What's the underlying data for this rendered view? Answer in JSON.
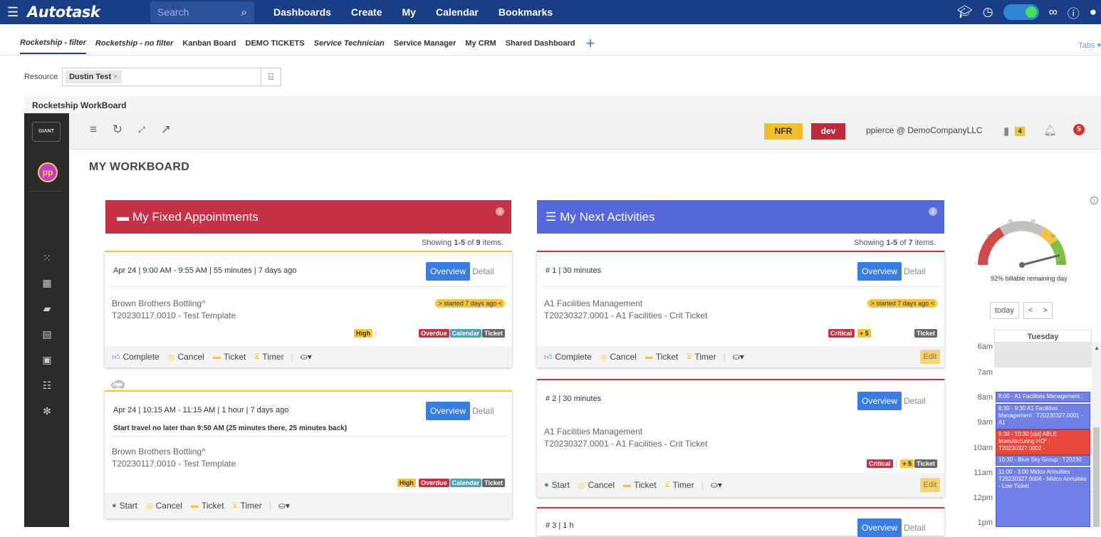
{
  "topnav": {
    "logo": "Autotask",
    "search_placeholder": "Search",
    "menu": [
      "Dashboards",
      "Create",
      "My",
      "Calendar",
      "Bookmarks"
    ]
  },
  "tabs": {
    "items": [
      "Rocketship - filter",
      "Rocketship - no filter",
      "Kanban Board",
      "DEMO TICKETS",
      "Service Technician",
      "Service Manager",
      "My CRM",
      "Shared Dashboard"
    ],
    "right_label": "Tabs"
  },
  "resource": {
    "label": "Resource",
    "chip": "Dustin Test",
    "chip_remove": "×"
  },
  "workboard": {
    "frame_title": "Rocketship WorkBoard",
    "logo_text": "GIANT",
    "avatar": "pp",
    "nfr": "NFR",
    "dev": "dev",
    "user": "ppierce @ DemoCompanyLLC",
    "clip_count": "4",
    "notif_count": "5",
    "page_title": "MY WORKBOARD"
  },
  "fixed": {
    "title": "My Fixed Appointments",
    "showing_prefix": "Showing ",
    "showing_range": "1-5",
    "showing_of": " of ",
    "showing_total": "9",
    "showing_suffix": " items.",
    "cards": [
      {
        "date": "Apr 24",
        "time": "9:00 AM - 9:55 AM",
        "duration": "55 minutes",
        "ago": "7 days ago",
        "overview": "Overview",
        "detail": "Detail",
        "started": "> started 7 days ago <",
        "client": "Brown Brothers Bottling^",
        "ticket": "T20230117.0010 - Test Template",
        "priority": "High",
        "tags": [
          "Overdue",
          "Calendar",
          "Ticket"
        ],
        "actions": [
          "Complete",
          "Cancel",
          "Ticket",
          "Timer"
        ]
      },
      {
        "date": "Apr 24",
        "time": "10:15 AM - 11:15 AM",
        "duration": "1 hour",
        "ago": "7 days ago",
        "travel": "Start travel no later than 9:50 AM (25 minutes there, 25 minutes back)",
        "overview": "Overview",
        "detail": "Detail",
        "client": "Brown Brothers Bottling^",
        "ticket": "T20230117.0010 - Test Template",
        "priority": "High",
        "tags": [
          "Overdue",
          "Calendar",
          "Ticket"
        ],
        "actions": [
          "Start",
          "Cancel",
          "Ticket",
          "Timer"
        ]
      }
    ]
  },
  "next": {
    "title": "My Next Activities",
    "showing_prefix": "Showing ",
    "showing_range": "1-5",
    "showing_of": " of ",
    "showing_total": "7",
    "showing_suffix": " items.",
    "cards": [
      {
        "num": "# 1",
        "duration": "30 minutes",
        "overview": "Overview",
        "detail": "Detail",
        "started": "> started 7 days ago <",
        "client": "A1 Facilities Management",
        "ticket": "T20230327.0001 - A1 Facilities - Crit Ticket",
        "priority": "Critical",
        "plus": "+ 5",
        "tag": "Ticket",
        "actions": [
          "Complete",
          "Cancel",
          "Ticket",
          "Timer"
        ],
        "edit": "Edit"
      },
      {
        "num": "# 2",
        "duration": "30 minutes",
        "overview": "Overview",
        "detail": "Detail",
        "client": "A1 Facilities Management",
        "ticket": "T20230327.0001 - A1 Facilities - Crit Ticket",
        "priority": "Critical",
        "plus": "+ 5",
        "tag": "Ticket",
        "actions": [
          "Start",
          "Cancel",
          "Ticket",
          "Timer"
        ],
        "edit": "Edit"
      },
      {
        "num": "# 3",
        "duration": "1 h",
        "overview": "Overview",
        "detail": "Detail"
      }
    ]
  },
  "gauge": {
    "value_percent": 92,
    "caption": "92% billable remaining day",
    "ticks": [
      "0",
      "20",
      "40",
      "60",
      "80",
      "100"
    ]
  },
  "calendar": {
    "today": "today",
    "prev": "<",
    "next": ">",
    "day": "Tuesday",
    "hours": [
      "6am",
      "7am",
      "8am",
      "9am",
      "10am",
      "11am",
      "12pm",
      "1pm"
    ],
    "events": [
      {
        "text": "8:00 - A1 Facilities Management :",
        "color": "#7080e6"
      },
      {
        "text": "8:30 - 9:30 A1 Facilities Management : T20230327.0001 - A1",
        "color": "#7080e6"
      },
      {
        "text": "9:30 - 10:30 [s|o] ABLE Manufacturing HO* : T20230327.0002 -",
        "color": "#e9493d"
      },
      {
        "text": "10:30 - Blue Sky Group : T20230",
        "color": "#7080e6"
      },
      {
        "text": "11:00 - 3:00 Midco Annuities : T20230327.0004 - Midco Annuities - Low Ticket",
        "color": "#7080e6"
      }
    ]
  }
}
